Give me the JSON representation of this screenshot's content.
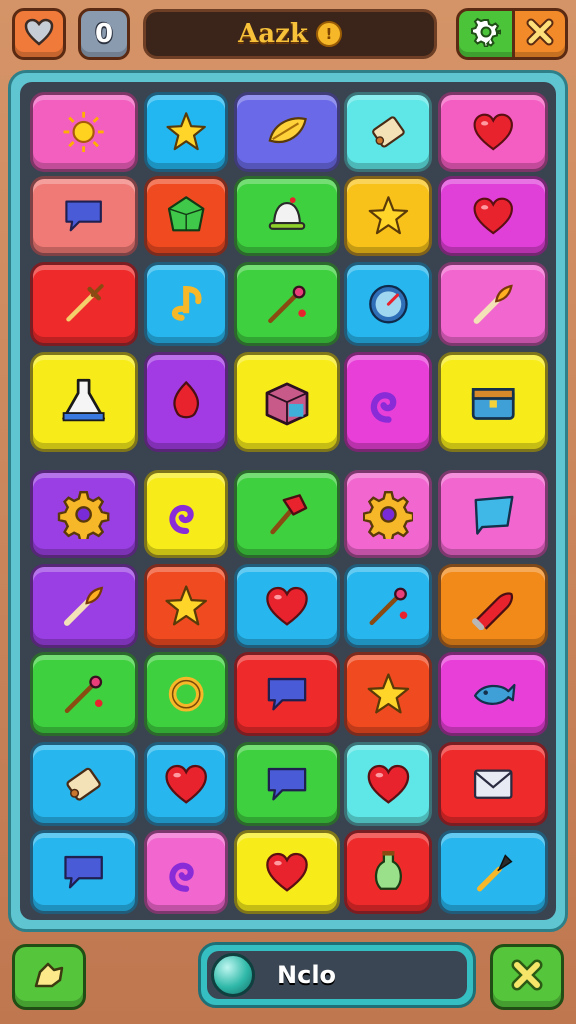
{
  "top_bar": {
    "lives_icon": "heart-icon",
    "score_value": "0",
    "title": "Aazk",
    "coin_symbol": "!",
    "settings_icon": "gear-icon",
    "close_icon": "close-icon"
  },
  "board": {
    "rows": [
      [
        {
          "color": "#f25fbf",
          "icon": "sun-icon"
        },
        {
          "color": "#22b7f0",
          "icon": "star-icon"
        },
        {
          "color": "#6a6ae8",
          "icon": "leaf-icon"
        },
        {
          "color": "#5fe6e6",
          "icon": "scroll-icon"
        },
        {
          "color": "#f45dc2",
          "icon": "heart-icon"
        }
      ],
      [
        {
          "color": "#f07a76",
          "icon": "speech-bubble-icon"
        },
        {
          "color": "#f04a20",
          "icon": "gem-icon"
        },
        {
          "color": "#3fd03f",
          "icon": "bell-icon"
        },
        {
          "color": "#f8c21a",
          "icon": "star-icon"
        },
        {
          "color": "#e03fd8",
          "icon": "heart-icon"
        }
      ],
      [
        {
          "color": "#ee2a2a",
          "icon": "sword-icon"
        },
        {
          "color": "#27b6ee",
          "icon": "music-note-icon"
        },
        {
          "color": "#3fd03f",
          "icon": "wand-icon"
        },
        {
          "color": "#27b6ee",
          "icon": "gauge-icon"
        },
        {
          "color": "#f266cf",
          "icon": "torch-icon"
        }
      ],
      [
        {
          "color": "#f7ec1a",
          "icon": "flask-icon"
        },
        {
          "color": "#a23be3",
          "icon": "flame-icon"
        },
        {
          "color": "#f7ec1a",
          "icon": "treasure-box-icon"
        },
        {
          "color": "#e83fd8",
          "icon": "swirl-icon"
        },
        {
          "color": "#f7ec1a",
          "icon": "chest-icon"
        }
      ],
      [
        {
          "color": "#9a3fe3",
          "icon": "gear-icon"
        },
        {
          "color": "#f7ec1a",
          "icon": "swirl-icon"
        },
        {
          "color": "#3fd03f",
          "icon": "hammer-icon"
        },
        {
          "color": "#f266cf",
          "icon": "gear-icon"
        },
        {
          "color": "#f266cf",
          "icon": "flag-icon"
        }
      ],
      [
        {
          "color": "#9a3fe3",
          "icon": "torch-icon"
        },
        {
          "color": "#f04a20",
          "icon": "star-icon"
        },
        {
          "color": "#27b6ee",
          "icon": "heart-icon"
        },
        {
          "color": "#27b6ee",
          "icon": "wand-icon"
        },
        {
          "color": "#f28a1a",
          "icon": "bullet-icon"
        }
      ],
      [
        {
          "color": "#3fd03f",
          "icon": "wand-icon"
        },
        {
          "color": "#3fd03f",
          "icon": "ring-icon"
        },
        {
          "color": "#ee2a2a",
          "icon": "speech-bubble-icon"
        },
        {
          "color": "#f04a20",
          "icon": "star-icon"
        },
        {
          "color": "#e83fd8",
          "icon": "fish-icon"
        }
      ],
      [
        {
          "color": "#27b6ee",
          "icon": "scroll-icon"
        },
        {
          "color": "#27b6ee",
          "icon": "heart-icon"
        },
        {
          "color": "#3fd03f",
          "icon": "speech-bubble-icon"
        },
        {
          "color": "#5fe6e6",
          "icon": "heart-icon"
        },
        {
          "color": "#ee2a2a",
          "icon": "envelope-icon"
        }
      ],
      [
        {
          "color": "#27b6ee",
          "icon": "speech-bubble-icon"
        },
        {
          "color": "#f266cf",
          "icon": "swirl-icon"
        },
        {
          "color": "#f7ec1a",
          "icon": "heart-icon"
        },
        {
          "color": "#ee2a2a",
          "icon": "potion-icon"
        },
        {
          "color": "#27b6ee",
          "icon": "brush-icon"
        }
      ]
    ]
  },
  "bottom_bar": {
    "left_button_icon": "shape-icon",
    "status_text": "Nclo",
    "right_button_icon": "close-icon"
  }
}
